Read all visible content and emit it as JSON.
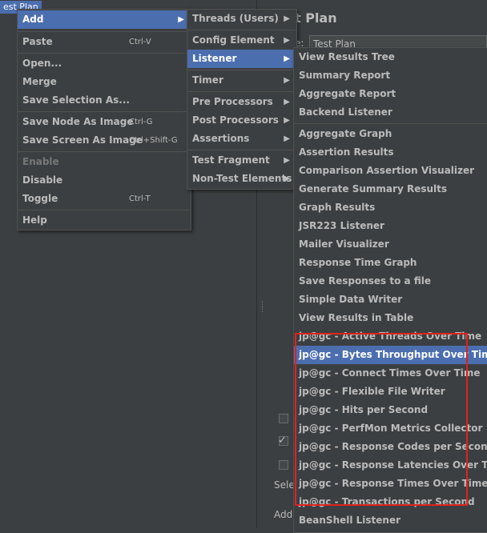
{
  "tree": {
    "selected_node": "est Plan"
  },
  "right_panel": {
    "title": "t Plan",
    "name_label": "e:",
    "name_value": "Test Plan",
    "select_text": "Sele",
    "add_text": "Add"
  },
  "context_menu": {
    "items": [
      {
        "label": "Add",
        "shortcut": "",
        "submenu": true,
        "selected": true,
        "enabled": true
      },
      {
        "label": "Paste",
        "shortcut": "Ctrl-V",
        "submenu": false,
        "selected": false,
        "enabled": true
      },
      {
        "label": "Open...",
        "shortcut": "",
        "submenu": false,
        "selected": false,
        "enabled": true
      },
      {
        "label": "Merge",
        "shortcut": "",
        "submenu": false,
        "selected": false,
        "enabled": true
      },
      {
        "label": "Save Selection As...",
        "shortcut": "",
        "submenu": false,
        "selected": false,
        "enabled": true
      },
      {
        "label": "Save Node As Image",
        "shortcut": "Ctrl-G",
        "submenu": false,
        "selected": false,
        "enabled": true
      },
      {
        "label": "Save Screen As Image",
        "shortcut": "Ctrl+Shift-G",
        "submenu": false,
        "selected": false,
        "enabled": true
      },
      {
        "label": "Enable",
        "shortcut": "",
        "submenu": false,
        "selected": false,
        "enabled": false
      },
      {
        "label": "Disable",
        "shortcut": "",
        "submenu": false,
        "selected": false,
        "enabled": true
      },
      {
        "label": "Toggle",
        "shortcut": "Ctrl-T",
        "submenu": false,
        "selected": false,
        "enabled": true
      },
      {
        "label": "Help",
        "shortcut": "",
        "submenu": false,
        "selected": false,
        "enabled": true
      }
    ]
  },
  "add_submenu": {
    "items": [
      {
        "label": "Threads (Users)",
        "selected": false
      },
      {
        "label": "Config Element",
        "selected": false
      },
      {
        "label": "Listener",
        "selected": true
      },
      {
        "label": "Timer",
        "selected": false
      },
      {
        "label": "Pre Processors",
        "selected": false
      },
      {
        "label": "Post Processors",
        "selected": false
      },
      {
        "label": "Assertions",
        "selected": false
      },
      {
        "label": "Test Fragment",
        "selected": false
      },
      {
        "label": "Non-Test Elements",
        "selected": false
      }
    ]
  },
  "listener_submenu": {
    "items": [
      {
        "label": "View Results Tree",
        "selected": false
      },
      {
        "label": "Summary Report",
        "selected": false
      },
      {
        "label": "Aggregate Report",
        "selected": false
      },
      {
        "label": "Backend Listener",
        "selected": false
      },
      {
        "label": "Aggregate Graph",
        "selected": false
      },
      {
        "label": "Assertion Results",
        "selected": false
      },
      {
        "label": "Comparison Assertion Visualizer",
        "selected": false
      },
      {
        "label": "Generate Summary Results",
        "selected": false
      },
      {
        "label": "Graph Results",
        "selected": false
      },
      {
        "label": "JSR223 Listener",
        "selected": false
      },
      {
        "label": "Mailer Visualizer",
        "selected": false
      },
      {
        "label": "Response Time Graph",
        "selected": false
      },
      {
        "label": "Save Responses to a file",
        "selected": false
      },
      {
        "label": "Simple Data Writer",
        "selected": false
      },
      {
        "label": "View Results in Table",
        "selected": false
      },
      {
        "label": "jp@gc - Active Threads Over Time",
        "selected": false
      },
      {
        "label": "jp@gc - Bytes Throughput Over Time",
        "selected": true
      },
      {
        "label": "jp@gc - Connect Times Over Time",
        "selected": false
      },
      {
        "label": "jp@gc - Flexible File Writer",
        "selected": false
      },
      {
        "label": "jp@gc - Hits per Second",
        "selected": false
      },
      {
        "label": "jp@gc - PerfMon Metrics Collector",
        "selected": false
      },
      {
        "label": "jp@gc - Response Codes per Second",
        "selected": false
      },
      {
        "label": "jp@gc - Response Latencies Over Time",
        "selected": false
      },
      {
        "label": "jp@gc - Response Times Over Time",
        "selected": false
      },
      {
        "label": "jp@gc - Transactions per Second",
        "selected": false
      },
      {
        "label": "BeanShell Listener",
        "selected": false
      }
    ]
  },
  "colors": {
    "menu_bg": "#3c3f41",
    "selection": "#4b6eaf",
    "annotation_box": "#e0221c"
  }
}
